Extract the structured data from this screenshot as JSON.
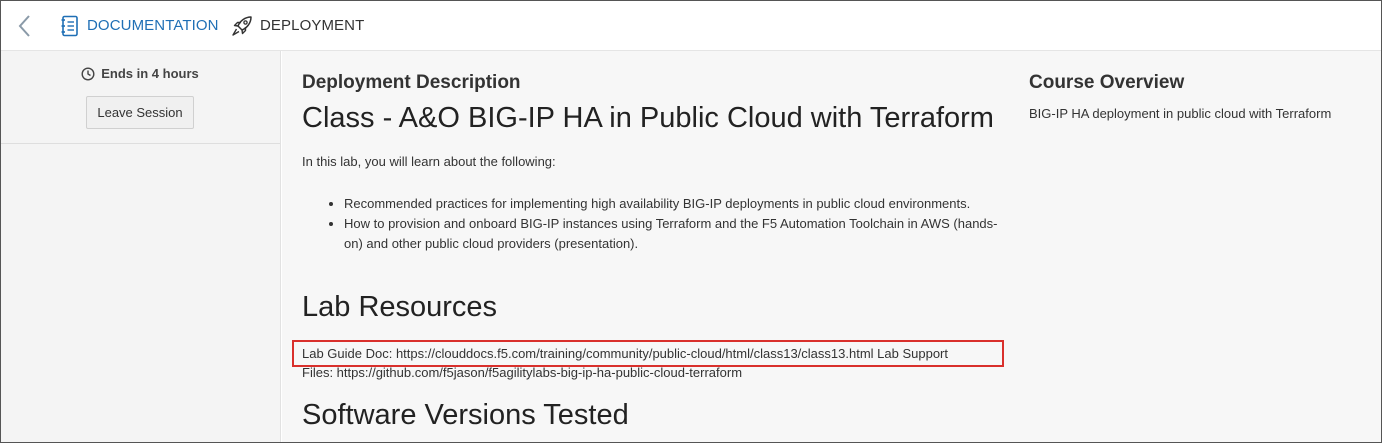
{
  "nav": {
    "back_icon": "chevron-left-icon",
    "tabs": [
      {
        "label": "DOCUMENTATION",
        "icon": "document-icon",
        "active": true,
        "color": "#1f6fb5"
      },
      {
        "label": "DEPLOYMENT",
        "icon": "rocket-icon",
        "active": false
      }
    ]
  },
  "sidebar": {
    "ends_text": "Ends in 4 hours",
    "leave_label": "Leave Session"
  },
  "main": {
    "section_title": "Deployment Description",
    "class_title": "Class - A&O BIG-IP HA in Public Cloud with Terraform",
    "intro": "In this lab, you will learn about the following:",
    "bullets": [
      "Recommended practices for implementing high availability BIG-IP deployments in public cloud environments.",
      "How to provision and onboard BIG-IP instances using Terraform and the F5 Automation Toolchain in AWS (hands-on) and other public cloud providers (presentation)."
    ],
    "lab_resources_title": "Lab Resources",
    "lab_resources_line1": "Lab Guide Doc: https://clouddocs.f5.com/training/community/public-cloud/html/class13/class13.html Lab Support",
    "lab_resources_line2": "Files: https://github.com/f5jason/f5agilitylabs-big-ip-ha-public-cloud-terraform",
    "software_title": "Software Versions Tested",
    "highlight_color": "#d9302c"
  },
  "overview": {
    "title": "Course Overview",
    "text": "BIG-IP HA deployment in public cloud with Terraform"
  }
}
